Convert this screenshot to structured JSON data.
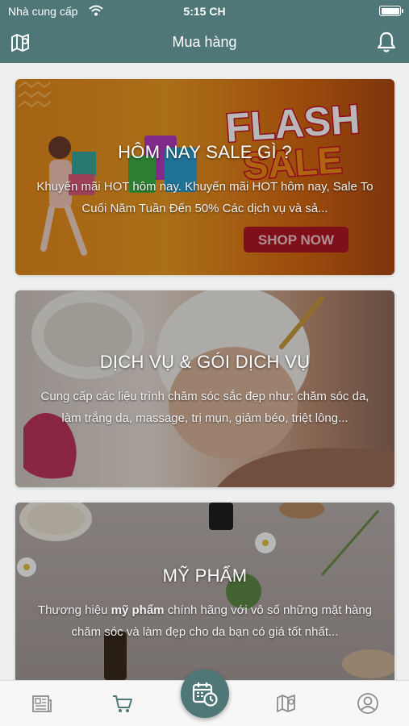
{
  "status_bar": {
    "carrier": "Nhà cung cấp",
    "time": "5:15 CH"
  },
  "header": {
    "title": "Mua hàng",
    "left_icon": "map-icon",
    "right_icon": "bell-icon",
    "background_color": "#4f7777"
  },
  "cards": [
    {
      "title": "HÔM NAY SALE GÌ ?",
      "description": "Khuyến mãi HOT hôm nay. Khuyến mãi HOT hôm nay, Sale To Cuối Năm Tuần Đến 50% Các dịch vụ và sả...",
      "image_text_line1": "FLASH",
      "image_text_line2": "SALE",
      "image_button": "SHOP NOW"
    },
    {
      "title": "DỊCH VỤ & GÓI DỊCH VỤ",
      "description": "Cung cấp các liệu trình chăm sóc sắc đẹp như: chăm sóc da, làm trắng da, massage, trị mụn, giảm béo, triệt lông..."
    },
    {
      "title": "MỸ PHẨM",
      "description_pre": "Thương hiệu ",
      "description_bold": "mỹ phẩm",
      "description_post": " chính hãng với vô số những mặt hàng chăm sóc và làm đẹp cho da bạn có giá tốt nhất..."
    }
  ],
  "tab_bar": {
    "items": [
      "news-icon",
      "cart-icon",
      "calendar-clock-icon",
      "map-icon",
      "profile-icon"
    ],
    "active": "cart-icon"
  }
}
